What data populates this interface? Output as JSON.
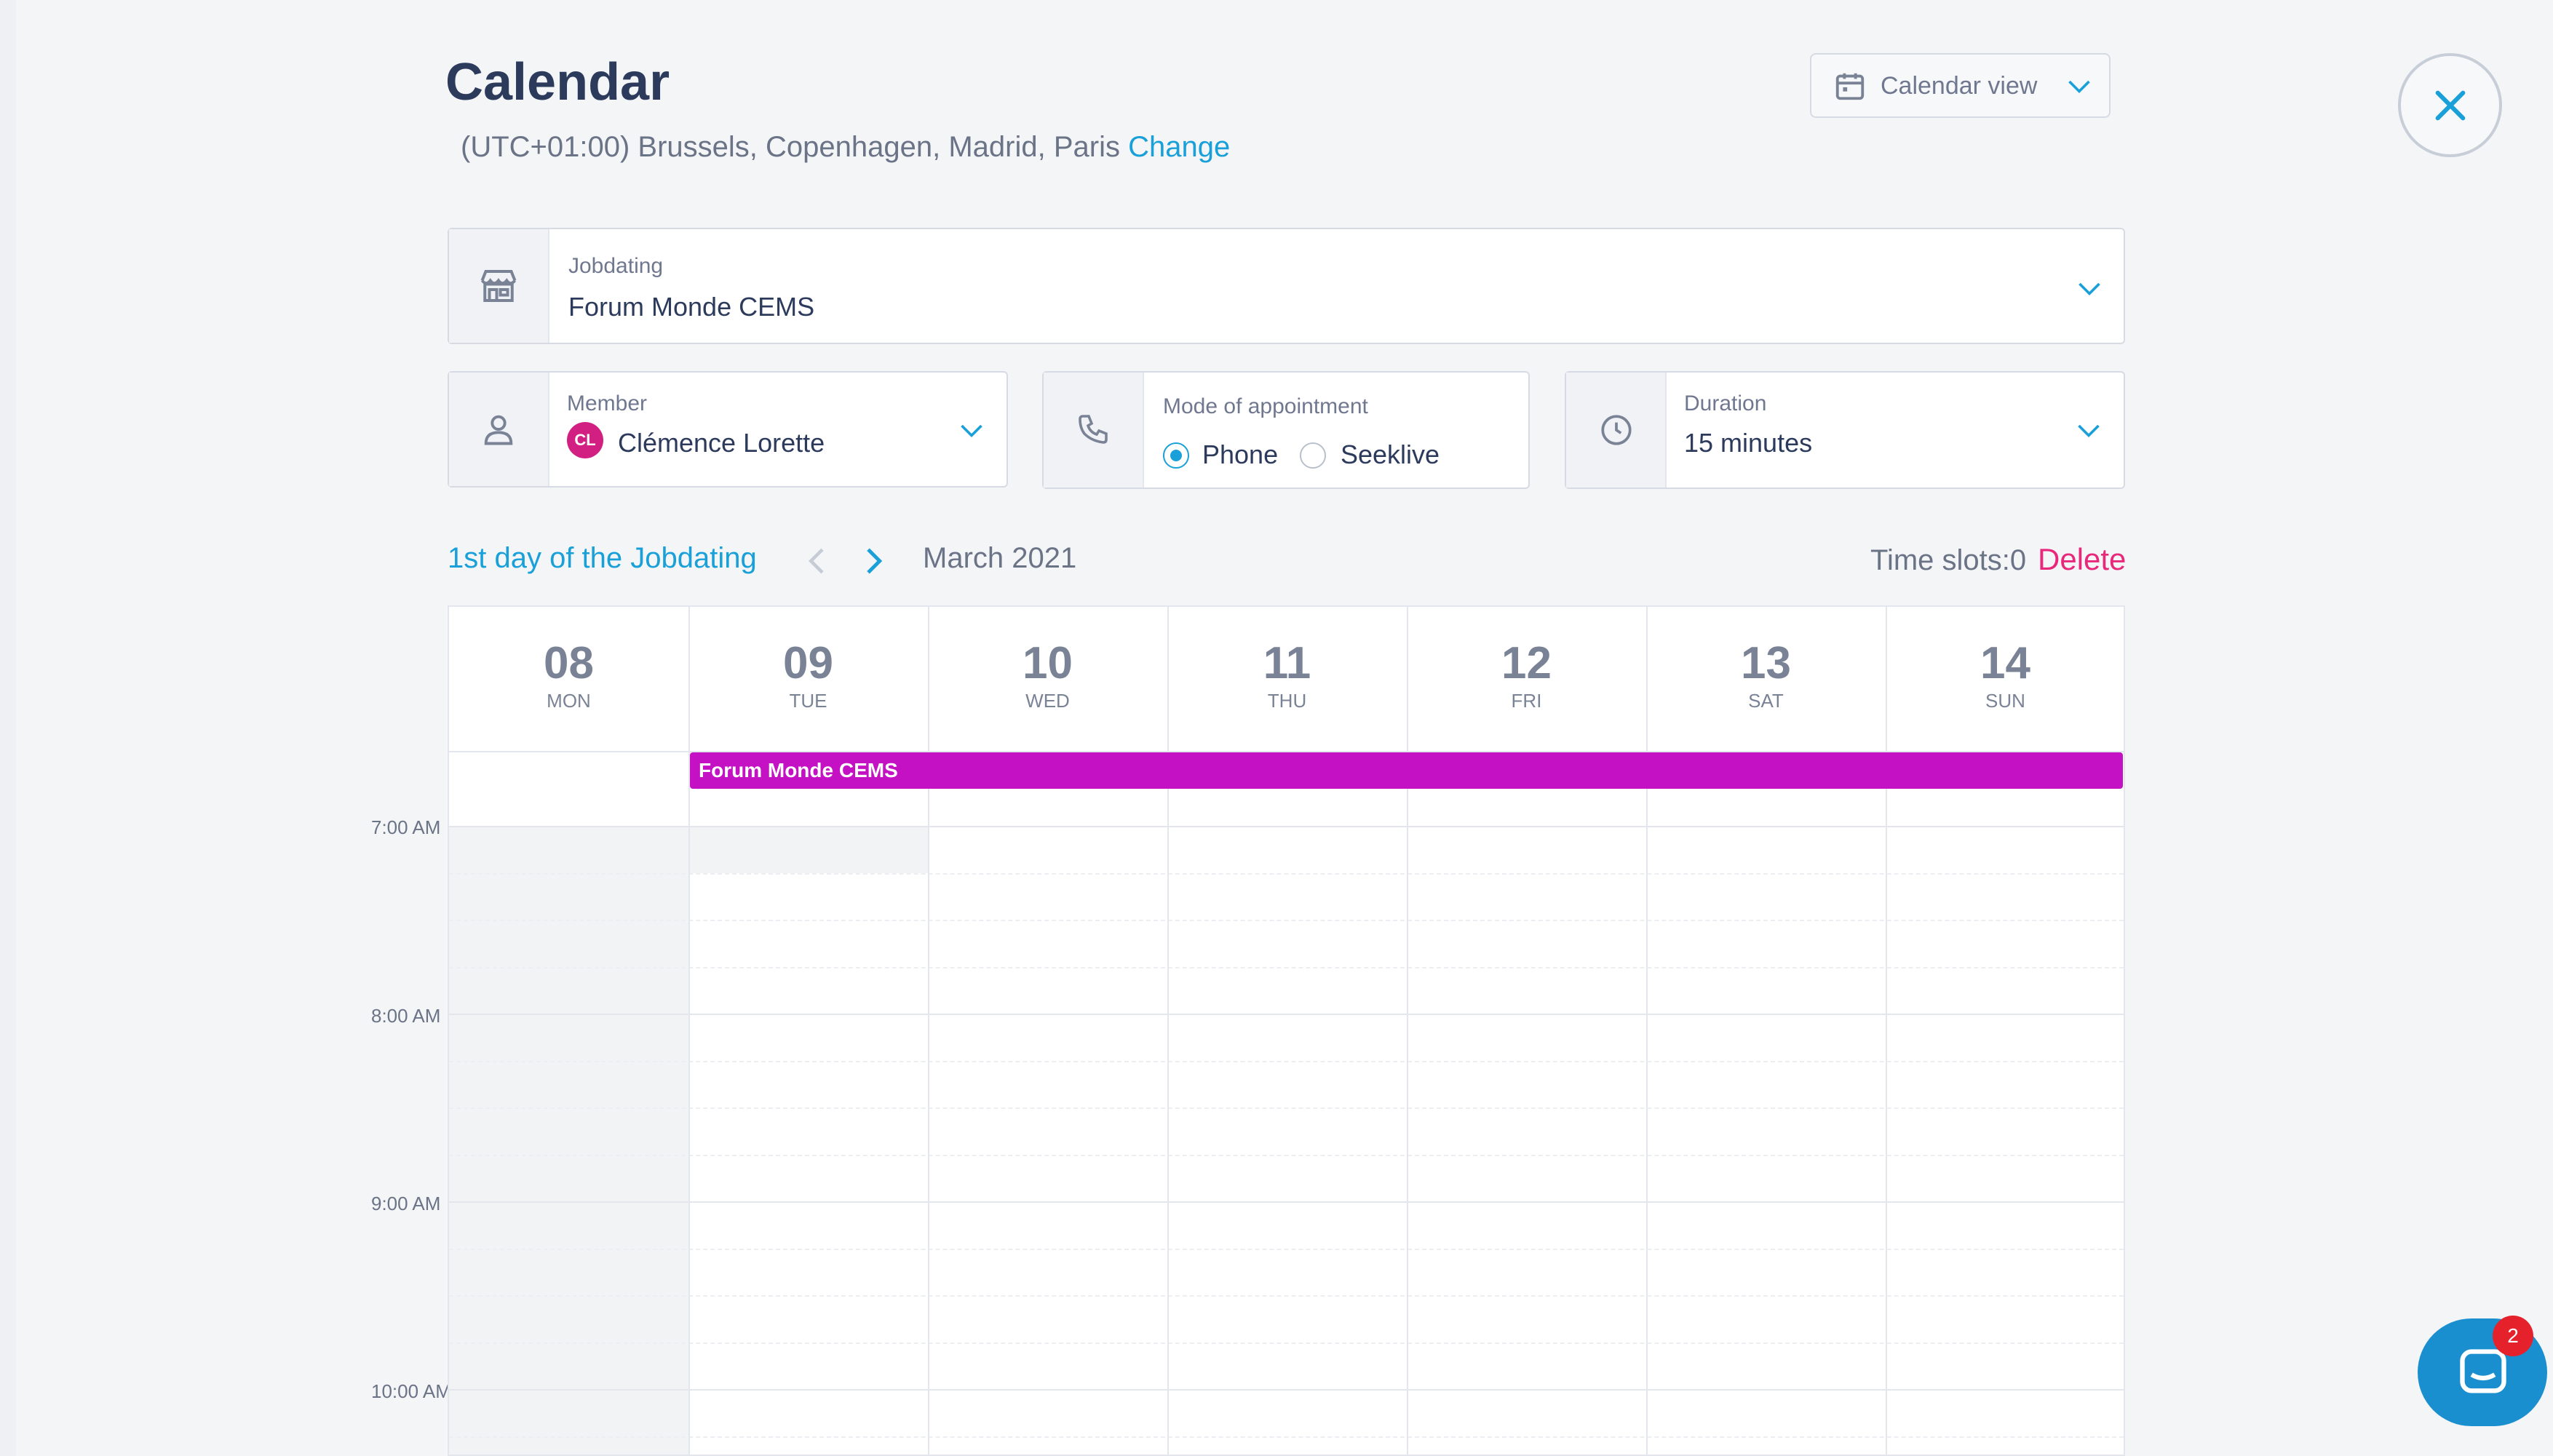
{
  "header": {
    "title": "Calendar",
    "timezone": "(UTC+01:00) Brussels, Copenhagen, Madrid, Paris",
    "change_label": "Change",
    "view_button_label": "Calendar view"
  },
  "filters": {
    "jobdating": {
      "label": "Jobdating",
      "value": "Forum Monde CEMS"
    },
    "member": {
      "label": "Member",
      "initials": "CL",
      "value": "Clémence Lorette"
    },
    "mode": {
      "label": "Mode of appointment",
      "options": [
        "Phone",
        "Seeklive"
      ],
      "selected": "Phone"
    },
    "duration": {
      "label": "Duration",
      "value": "15 minutes"
    }
  },
  "nav": {
    "first_day_label": "1st day of the Jobdating",
    "month": "March 2021",
    "time_slots_label": "Time slots:",
    "time_slots_count": "0",
    "delete_label": "Delete"
  },
  "week": [
    {
      "num": "08",
      "name": "MON"
    },
    {
      "num": "09",
      "name": "TUE"
    },
    {
      "num": "10",
      "name": "WED"
    },
    {
      "num": "11",
      "name": "THU"
    },
    {
      "num": "12",
      "name": "FRI"
    },
    {
      "num": "13",
      "name": "SAT"
    },
    {
      "num": "14",
      "name": "SUN"
    }
  ],
  "event": {
    "title": "Forum Monde CEMS",
    "start_day": "09",
    "end_day": "14"
  },
  "time_labels": [
    "7:00 AM",
    "8:00 AM",
    "9:00 AM",
    "10:00 AM"
  ],
  "chat": {
    "badge_count": "2"
  },
  "colors": {
    "accent": "#1aa0d8",
    "event": "#c411c4",
    "delete": "#e8287a",
    "avatar": "#d21f82"
  },
  "icons": [
    "calendar-icon",
    "chevron-down-icon",
    "close-icon",
    "store-icon",
    "user-icon",
    "phone-icon",
    "clock-icon",
    "chevron-left-icon",
    "chevron-right-icon",
    "chat-icon"
  ]
}
